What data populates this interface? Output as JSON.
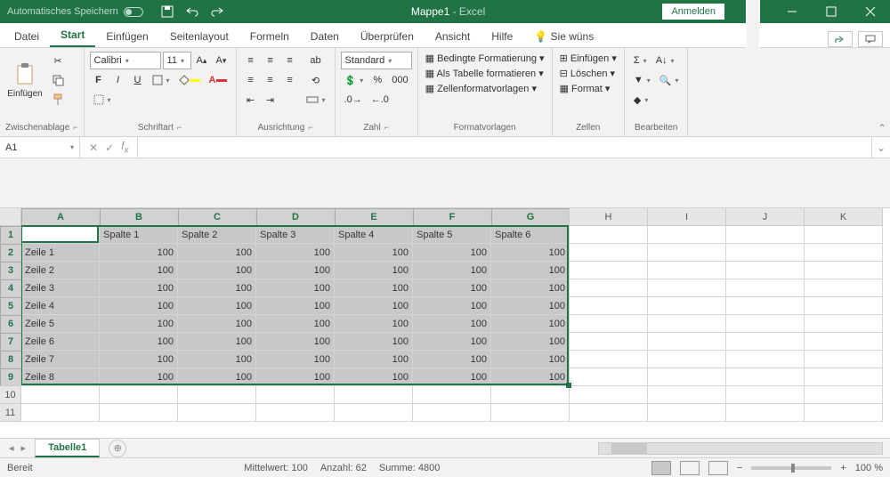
{
  "titlebar": {
    "autosave": "Automatisches Speichern",
    "title": "Mappe1",
    "app": " - Excel",
    "signin": "Anmelden"
  },
  "tabs": {
    "datei": "Datei",
    "start": "Start",
    "einfuegen": "Einfügen",
    "seitenlayout": "Seitenlayout",
    "formeln": "Formeln",
    "daten": "Daten",
    "ueberpruefen": "Überprüfen",
    "ansicht": "Ansicht",
    "hilfe": "Hilfe",
    "tellme": "Sie wüns"
  },
  "ribbon": {
    "clipboard": {
      "label": "Zwischenablage",
      "paste": "Einfügen"
    },
    "font": {
      "label": "Schriftart",
      "name": "Calibri",
      "size": "11",
      "bold": "F",
      "italic": "I",
      "underline": "U"
    },
    "alignment": {
      "label": "Ausrichtung",
      "wrap": "ab"
    },
    "number": {
      "label": "Zahl",
      "format": "Standard"
    },
    "styles": {
      "label": "Formatvorlagen",
      "cond": "Bedingte Formatierung",
      "table": "Als Tabelle formatieren",
      "cell": "Zellenformatvorlagen"
    },
    "cells": {
      "label": "Zellen",
      "insert": "Einfügen",
      "delete": "Löschen",
      "format": "Format"
    },
    "editing": {
      "label": "Bearbeiten"
    }
  },
  "namebox": "A1",
  "columns": [
    "A",
    "B",
    "C",
    "D",
    "E",
    "F",
    "G",
    "H",
    "I",
    "J",
    "K"
  ],
  "rownums": [
    "1",
    "2",
    "3",
    "4",
    "5",
    "6",
    "7",
    "8",
    "9",
    "10",
    "11"
  ],
  "selectedCols": 7,
  "selectedRows": 9,
  "table": {
    "headers": [
      "",
      "Spalte 1",
      "Spalte 2",
      "Spalte 3",
      "Spalte 4",
      "Spalte 5",
      "Spalte 6"
    ],
    "rowLabels": [
      "Zeile 1",
      "Zeile 2",
      "Zeile 3",
      "Zeile 4",
      "Zeile 5",
      "Zeile 6",
      "Zeile 7",
      "Zeile 8"
    ],
    "value": "100"
  },
  "sheet": {
    "name": "Tabelle1"
  },
  "status": {
    "ready": "Bereit",
    "avg_label": "Mittelwert:",
    "avg": "100",
    "count_label": "Anzahl:",
    "count": "62",
    "sum_label": "Summe:",
    "sum": "4800",
    "zoom": "100 %"
  }
}
